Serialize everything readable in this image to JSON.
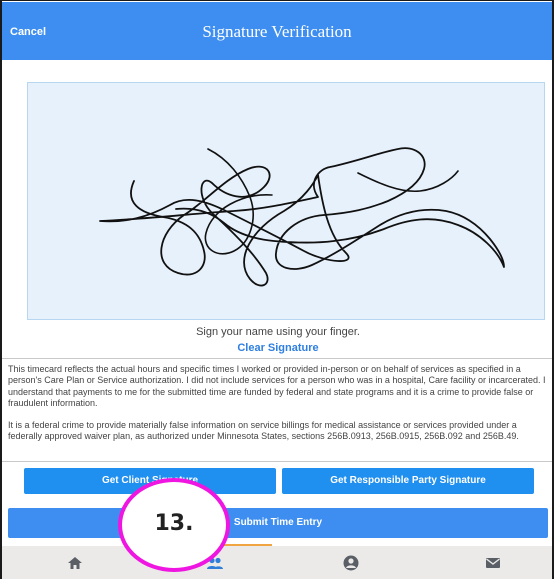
{
  "header": {
    "cancel_label": "Cancel",
    "title": "Signature Verification"
  },
  "signature": {
    "hint": "Sign your name using your finger.",
    "clear_label": "Clear Signature"
  },
  "legal": {
    "paragraph_1": "This timecard reflects the actual hours and specific times I worked or provided in-person or on behalf of services as specified in a person's Care Plan or Service authorization. I did not include services for a person who was in a hospital, Care facility or incarcerated. I understand that payments to me for the submitted time are funded by federal and state programs and it is a crime to provide false or fraudulent information.",
    "paragraph_2": "It is a federal crime to provide materially false information on service billings for medical assistance or services provided under a federally approved waiver plan, as authorized under Minnesota States, sections 256B.0913, 256B.0915, 256B.092 and 256B.49."
  },
  "actions": {
    "client_signature_label": "Get Client Signature",
    "responsible_party_label": "Get Responsible Party Signature",
    "submit_label": "Submit Time Entry"
  },
  "annotation": {
    "step_label": "13."
  },
  "tabbar": {
    "tabs": [
      {
        "name": "home",
        "icon": "home-icon",
        "active": false
      },
      {
        "name": "people",
        "icon": "people-icon",
        "active": true
      },
      {
        "name": "account",
        "icon": "user-circle-icon",
        "active": false
      },
      {
        "name": "messages",
        "icon": "mail-icon",
        "active": false
      }
    ]
  },
  "colors": {
    "header": "#3d8ef0",
    "button": "#1f8ff0",
    "annotation_ring": "#ee16e0",
    "tab_indicator": "#f0a540",
    "signature_pad": "#e7f1fb"
  }
}
